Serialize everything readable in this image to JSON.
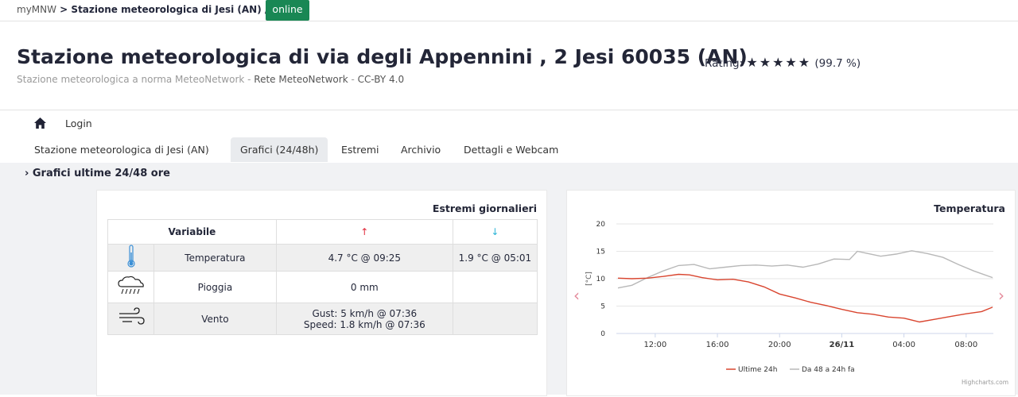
{
  "breadcrumb": {
    "home": "myMNW",
    "sep": " > ",
    "current": "Stazione meteorologica di Jesi (AN) /",
    "status": "online"
  },
  "header": {
    "title": "Stazione meteorologica di via degli Appennini , 2 Jesi 60035 (AN)",
    "rating_label": "Rating:",
    "rating_stars": "★★★★★",
    "rating_value": "(99.7 %)",
    "subtitle_a": "Stazione meteorologica a norma MeteoNetwork",
    "subtitle_sep1": " - ",
    "subtitle_b": "Rete MeteoNetwork",
    "subtitle_sep2": " - ",
    "subtitle_c": "CC-BY 4.0"
  },
  "nav": {
    "login": "Login"
  },
  "tabs": [
    {
      "label": "Stazione meteorologica di Jesi (AN)"
    },
    {
      "label": "Grafici (24/48h)"
    },
    {
      "label": "Estremi"
    },
    {
      "label": "Archivio"
    },
    {
      "label": "Dettagli e Webcam"
    }
  ],
  "section_title": "Grafici ultime 24/48 ore",
  "extremes": {
    "title": "Estremi giornalieri",
    "col_variable": "Variabile",
    "col_max": "↑",
    "col_min": "↓",
    "max_color": "#e0293a",
    "min_color": "#2bb3d6",
    "rows": [
      {
        "icon": "thermometer-icon",
        "name": "Temperatura",
        "max": "4.7 °C @ 09:25",
        "min": "1.9 °C @ 05:01"
      },
      {
        "icon": "rain-cloud-icon",
        "name": "Pioggia",
        "max": "0 mm",
        "min": ""
      },
      {
        "icon": "wind-icon",
        "name": "Vento",
        "max_a": "Gust: 5 km/h @ 07:36",
        "max_b": "Speed: 1.8 km/h @ 07:36",
        "min": ""
      }
    ]
  },
  "chart_data": {
    "type": "line",
    "title": "Temperatura",
    "ylabel": "[°C]",
    "ylim": [
      0,
      20
    ],
    "yticks": [
      0,
      5,
      10,
      15,
      20
    ],
    "xlim_hours": [
      9.5,
      33.75
    ],
    "xticks": [
      {
        "h": 12,
        "label": "12:00"
      },
      {
        "h": 16,
        "label": "16:00"
      },
      {
        "h": 20,
        "label": "20:00"
      },
      {
        "h": 24,
        "label": "26/11"
      },
      {
        "h": 28,
        "label": "04:00"
      },
      {
        "h": 32,
        "label": "08:00"
      }
    ],
    "series": [
      {
        "name": "Ultime 24h",
        "color": "#d9452f",
        "points": [
          [
            9.6,
            10.1
          ],
          [
            10.5,
            10.0
          ],
          [
            11.5,
            10.1
          ],
          [
            12.5,
            10.4
          ],
          [
            13.5,
            10.8
          ],
          [
            14.2,
            10.7
          ],
          [
            15,
            10.2
          ],
          [
            16,
            9.8
          ],
          [
            17,
            9.9
          ],
          [
            18,
            9.4
          ],
          [
            19,
            8.5
          ],
          [
            20,
            7.2
          ],
          [
            21,
            6.5
          ],
          [
            22,
            5.7
          ],
          [
            23,
            5.1
          ],
          [
            24,
            4.4
          ],
          [
            25,
            3.8
          ],
          [
            26,
            3.5
          ],
          [
            27,
            3.0
          ],
          [
            28,
            2.8
          ],
          [
            29,
            2.1
          ],
          [
            30,
            2.6
          ],
          [
            31,
            3.1
          ],
          [
            32,
            3.6
          ],
          [
            33,
            4.0
          ],
          [
            33.7,
            4.8
          ]
        ]
      },
      {
        "name": "Da 48 a 24h fa",
        "color": "#b8b8b8",
        "points": [
          [
            9.6,
            8.3
          ],
          [
            10.5,
            8.8
          ],
          [
            11.5,
            10.2
          ],
          [
            12.5,
            11.4
          ],
          [
            13.5,
            12.4
          ],
          [
            14.5,
            12.6
          ],
          [
            15.5,
            11.8
          ],
          [
            16.5,
            12.1
          ],
          [
            17.5,
            12.4
          ],
          [
            18.5,
            12.5
          ],
          [
            19.5,
            12.3
          ],
          [
            20.5,
            12.5
          ],
          [
            21.5,
            12.1
          ],
          [
            22.5,
            12.7
          ],
          [
            23.5,
            13.6
          ],
          [
            24.5,
            13.5
          ],
          [
            25,
            15.0
          ],
          [
            25.5,
            14.7
          ],
          [
            26.5,
            14.1
          ],
          [
            27.5,
            14.5
          ],
          [
            28.5,
            15.1
          ],
          [
            29.5,
            14.6
          ],
          [
            30.5,
            13.9
          ],
          [
            31.5,
            12.6
          ],
          [
            32.5,
            11.4
          ],
          [
            33.7,
            10.2
          ]
        ]
      }
    ],
    "credit": "Highcharts.com"
  }
}
